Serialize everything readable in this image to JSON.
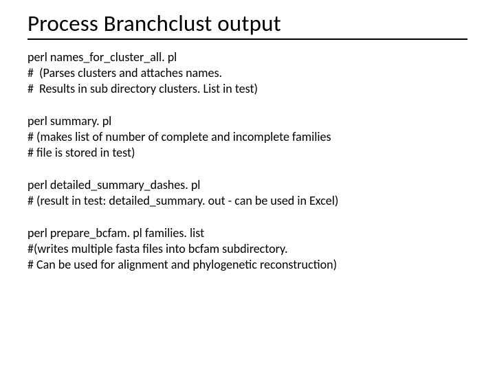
{
  "title": "Process Branchclust output",
  "blocks": [
    {
      "lines": [
        "perl names_for_cluster_all. pl",
        "#  (Parses clusters and attaches names.",
        "#  Results in sub directory clusters. List in test)"
      ]
    },
    {
      "lines": [
        "perl summary. pl",
        "# (makes list of number of complete and incomplete families",
        "# file is stored in test)"
      ]
    },
    {
      "lines": [
        "perl detailed_summary_dashes. pl",
        "# (result in test: detailed_summary. out - can be used in Excel)"
      ]
    },
    {
      "lines": [
        "perl prepare_bcfam. pl families. list",
        "#(writes multiple fasta files into bcfam subdirectory.",
        "# Can be used for alignment and phylogenetic reconstruction)"
      ]
    }
  ]
}
